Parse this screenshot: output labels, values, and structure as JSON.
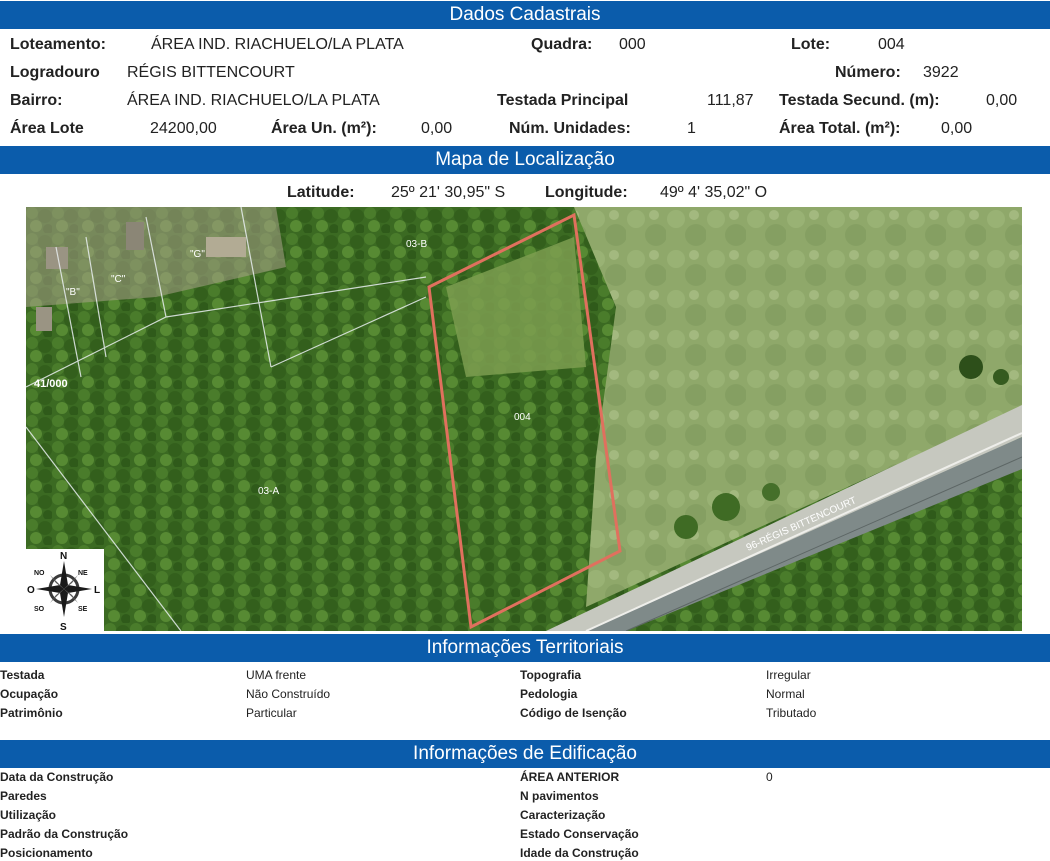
{
  "dados": {
    "title": "Dados Cadastrais",
    "loteamento_label": "Loteamento:",
    "loteamento": "ÁREA IND. RIACHUELO/LA PLATA",
    "quadra_label": "Quadra:",
    "quadra": "000",
    "lote_label": "Lote:",
    "lote": "004",
    "logradouro_label": "Logradouro",
    "logradouro": "RÉGIS BITTENCOURT",
    "numero_label": "Número:",
    "numero": "3922",
    "bairro_label": "Bairro:",
    "bairro": "ÁREA IND. RIACHUELO/LA PLATA",
    "testada_principal_label": "Testada Principal",
    "testada_principal": "111,87",
    "testada_secund_label": "Testada Secund. (m):",
    "testada_secund": "0,00",
    "area_lote_label": "Área Lote",
    "area_lote": "24200,00",
    "area_un_label": "Área Un. (m²):",
    "area_un": "0,00",
    "num_unidades_label": "Núm. Unidades:",
    "num_unidades": "1",
    "area_total_label": "Área Total. (m²):",
    "area_total": "0,00"
  },
  "mapa": {
    "title": "Mapa de Localização",
    "latitude_label": "Latitude:",
    "latitude": "25º 21' 30,95\" S",
    "longitude_label": "Longitude:",
    "longitude": "49º 4' 35,02\" O",
    "labels": {
      "g": "\"G\"",
      "c": "\"C\"",
      "b": "\"B\"",
      "b03": "03-B",
      "a03": "03-A",
      "lote004": "004",
      "q41": "41/000",
      "road": "96-RÉGIS BITTENCOURT"
    },
    "compass": {
      "n": "N",
      "s": "S",
      "l": "L",
      "o": "O",
      "no": "NO",
      "ne": "NE",
      "so": "SO",
      "se": "SE"
    }
  },
  "territoriais": {
    "title": "Informações Territoriais",
    "rows": [
      {
        "label": "Testada",
        "value": "UMA frente",
        "label2": "Topografia",
        "value2": "Irregular"
      },
      {
        "label": "Ocupação",
        "value": "Não Construído",
        "label2": "Pedologia",
        "value2": "Normal"
      },
      {
        "label": "Patrimônio",
        "value": "Particular",
        "label2": "Código de Isenção",
        "value2": "Tributado"
      }
    ]
  },
  "edificacao": {
    "title": "Informações de Edificação",
    "rows": [
      {
        "label": "Data da Construção",
        "label2": "ÁREA ANTERIOR",
        "value2": "0"
      },
      {
        "label": "Paredes",
        "label2": "N pavimentos",
        "value2": ""
      },
      {
        "label": "Utilização",
        "label2": "Caracterização",
        "value2": ""
      },
      {
        "label": "Padrão da Construção",
        "label2": "Estado Conservação",
        "value2": ""
      },
      {
        "label": "Posicionamento",
        "label2": "Idade da Construção",
        "value2": ""
      }
    ]
  },
  "colors": {
    "header_bar": "#0b5cab",
    "lot_outline": "#e0705e"
  }
}
